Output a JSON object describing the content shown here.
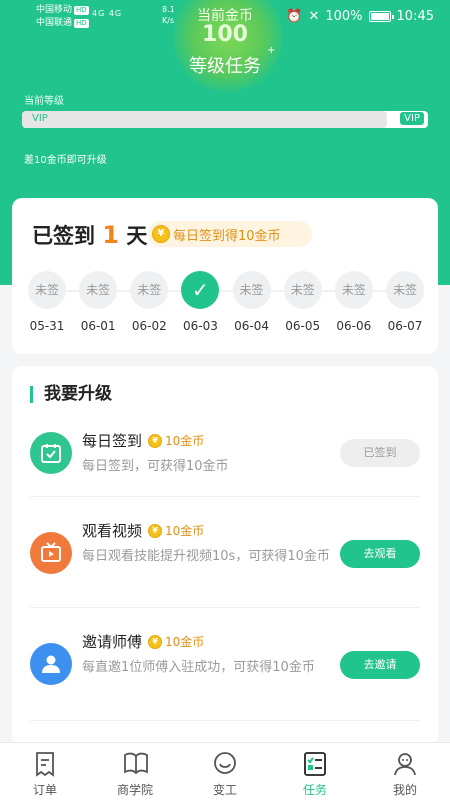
{
  "status_bar": {
    "carrier1": "中国移动",
    "carrier2": "中国联通",
    "hd": "HD",
    "signal": "4G 4G",
    "speed": "8.1",
    "speed_unit": "K/s",
    "battery": "100%",
    "time": "10:45"
  },
  "header": {
    "coin_label": "当前金币",
    "coin_value": "100",
    "title": "等级任务",
    "level_label": "当前等级",
    "level_current": "VIP",
    "level_next": "VIP",
    "level_progress": 0.9,
    "upgrade_hint": "差10金币即可升级"
  },
  "signin": {
    "prefix": "已签到",
    "days": "1",
    "suffix": "天",
    "coin_symbol": "¥",
    "daily_reward": "每日签到得10金币",
    "days_list": [
      {
        "state": "未签",
        "date": "05-31",
        "checked": false
      },
      {
        "state": "未签",
        "date": "06-01",
        "checked": false
      },
      {
        "state": "未签",
        "date": "06-02",
        "checked": false
      },
      {
        "state": "✓",
        "date": "06-03",
        "checked": true
      },
      {
        "state": "未签",
        "date": "06-04",
        "checked": false
      },
      {
        "state": "未签",
        "date": "06-05",
        "checked": false
      },
      {
        "state": "未签",
        "date": "06-06",
        "checked": false
      },
      {
        "state": "未签",
        "date": "06-07",
        "checked": false
      }
    ]
  },
  "upgrade": {
    "title": "我要升级",
    "tasks": [
      {
        "name": "每日签到",
        "reward": "10金币",
        "desc": "每日签到，可获得10金币",
        "button": "已签到",
        "icon": "calendar-check-icon"
      },
      {
        "name": "观看视频",
        "reward": "10金币",
        "desc": "每日观看技能提升视频10s，可获得10金币",
        "button": "去观看",
        "icon": "tv-icon"
      },
      {
        "name": "邀请师傅",
        "reward": "10金币",
        "desc": "每直邀1位师傅入驻成功，可获得10金币",
        "button": "去邀请",
        "icon": "user-icon"
      }
    ]
  },
  "tabbar": {
    "tabs": [
      {
        "label": "订单",
        "icon": "order-icon"
      },
      {
        "label": "商学院",
        "icon": "book-icon"
      },
      {
        "label": "变工",
        "icon": "smile-icon"
      },
      {
        "label": "任务",
        "icon": "task-icon"
      },
      {
        "label": "我的",
        "icon": "profile-icon"
      }
    ],
    "active_index": 3
  },
  "colors": {
    "brand": "#21c48c",
    "accent": "#f08519",
    "reward": "#e0901a"
  }
}
